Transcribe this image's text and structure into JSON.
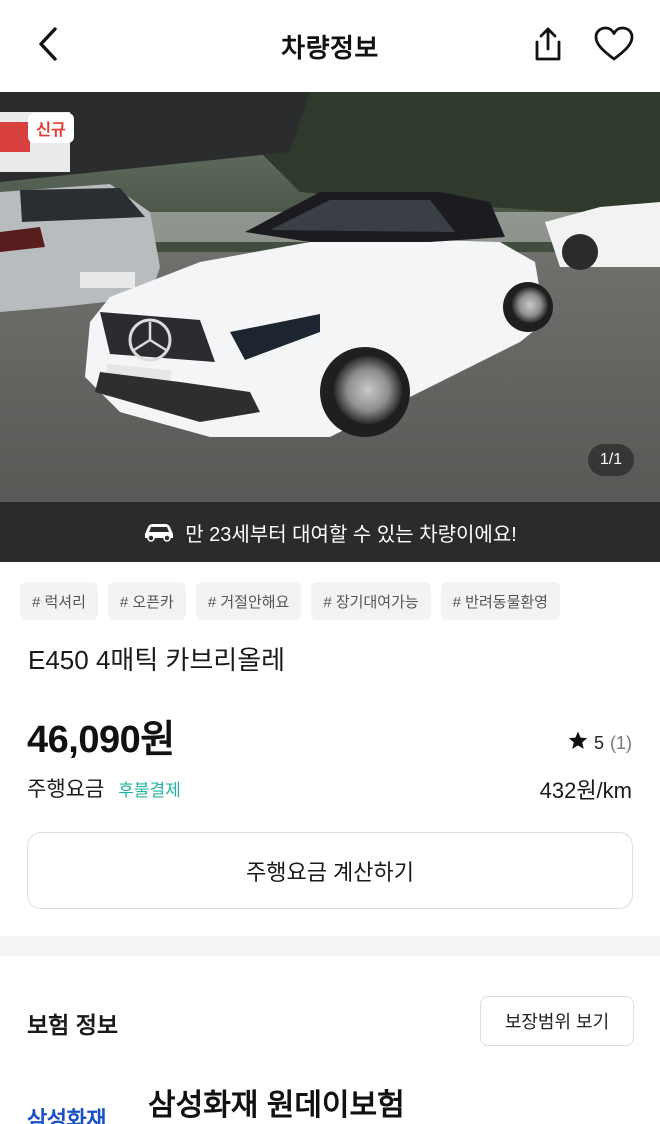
{
  "header": {
    "title": "차량정보",
    "back_icon": "chevron-left-icon",
    "share_icon": "share-icon",
    "favorite_icon": "heart-icon"
  },
  "photo": {
    "badge": "신규",
    "counter": "1/1",
    "badge_color": "#e8382f"
  },
  "notice": {
    "icon": "car-icon",
    "text": "만 23세부터 대여할 수 있는 차량이에요!"
  },
  "tags": [
    "# 럭셔리",
    "# 오픈카",
    "# 거절안해요",
    "# 장기대여가능",
    "# 반려동물환영"
  ],
  "car": {
    "name": "E450 4매틱 카브리올레",
    "price": "46,090원",
    "rating_icon": "star-icon",
    "rating": "5",
    "rating_count": "(1)"
  },
  "fee": {
    "label": "주행요금",
    "tag": "후불결제",
    "rate": "432원/km",
    "tag_color": "#27b3a2",
    "calc_button": "주행요금 계산하기"
  },
  "insurance": {
    "title": "보험 정보",
    "coverage_button": "보장범위 보기",
    "logo_text": "삼성화재",
    "product_name": "삼성화재 원데이보험",
    "logo_color": "#1a4fc7"
  }
}
